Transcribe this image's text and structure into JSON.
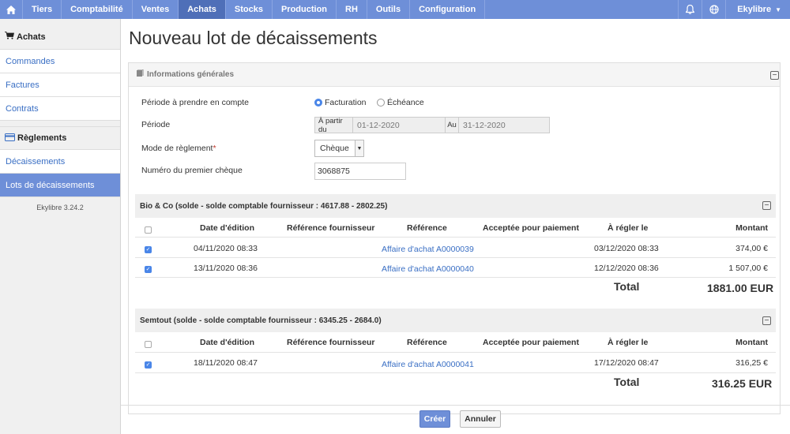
{
  "topbar": {
    "items": [
      {
        "label": "Tiers"
      },
      {
        "label": "Comptabilité"
      },
      {
        "label": "Ventes"
      },
      {
        "label": "Achats",
        "active": true
      },
      {
        "label": "Stocks"
      },
      {
        "label": "Production"
      },
      {
        "label": "RH"
      },
      {
        "label": "Outils"
      },
      {
        "label": "Configuration"
      }
    ],
    "user": "Ekylibre",
    "accent": "#6e8fd8"
  },
  "sidebar": {
    "section1": {
      "title": "Achats",
      "icon": "cart-icon"
    },
    "items1": [
      {
        "label": "Commandes"
      },
      {
        "label": "Factures"
      },
      {
        "label": "Contrats"
      }
    ],
    "section2": {
      "title": "Règlements",
      "icon": "credit-card-icon"
    },
    "items2": [
      {
        "label": "Décaissements"
      },
      {
        "label": "Lots de décaissements",
        "active": true
      }
    ],
    "version": "Ekylibre 3.24.2"
  },
  "main": {
    "title": "Nouveau lot de décaissements",
    "general": {
      "title": "Informations générales",
      "periode_compte": {
        "label": "Période à prendre en compte",
        "options": [
          "Facturation",
          "Échéance"
        ],
        "selected": "Facturation"
      },
      "periode": {
        "label": "Période",
        "from_label": "À partir du",
        "from_value": "01-12-2020",
        "to_label": "Au",
        "to_value": "31-12-2020"
      },
      "mode": {
        "label": "Mode de règlement",
        "required_mark": "*",
        "value": "Chèque"
      },
      "cheque": {
        "label": "Numéro du premier chèque",
        "value": "3068875"
      }
    },
    "columns": [
      "Date d'édition",
      "Référence fournisseur",
      "Référence",
      "Acceptée pour paiement",
      "À régler le",
      "Montant"
    ],
    "suppliers": [
      {
        "title": "Bio & Co (solde - solde comptable fournisseur : 4617.88 - 2802.25)",
        "rows": [
          {
            "date": "04/11/2020 08:33",
            "ref_fournisseur": "",
            "reference": "Affaire d'achat A0000039",
            "acceptee": "",
            "a_regler": "03/12/2020 08:33",
            "montant": "374,00 €",
            "checked": true
          },
          {
            "date": "13/11/2020 08:36",
            "ref_fournisseur": "",
            "reference": "Affaire d'achat A0000040",
            "acceptee": "",
            "a_regler": "12/12/2020 08:36",
            "montant": "1 507,00 €",
            "checked": true
          }
        ],
        "total_label": "Total",
        "total": "1881.00 EUR"
      },
      {
        "title": "Semtout (solde - solde comptable fournisseur : 6345.25 - 2684.0)",
        "rows": [
          {
            "date": "18/11/2020 08:47",
            "ref_fournisseur": "",
            "reference": "Affaire d'achat A0000041",
            "acceptee": "",
            "a_regler": "17/12/2020 08:47",
            "montant": "316,25 €",
            "checked": true
          }
        ],
        "total_label": "Total",
        "total": "316.25 EUR"
      }
    ],
    "actions": {
      "create": "Créer",
      "cancel": "Annuler"
    }
  }
}
